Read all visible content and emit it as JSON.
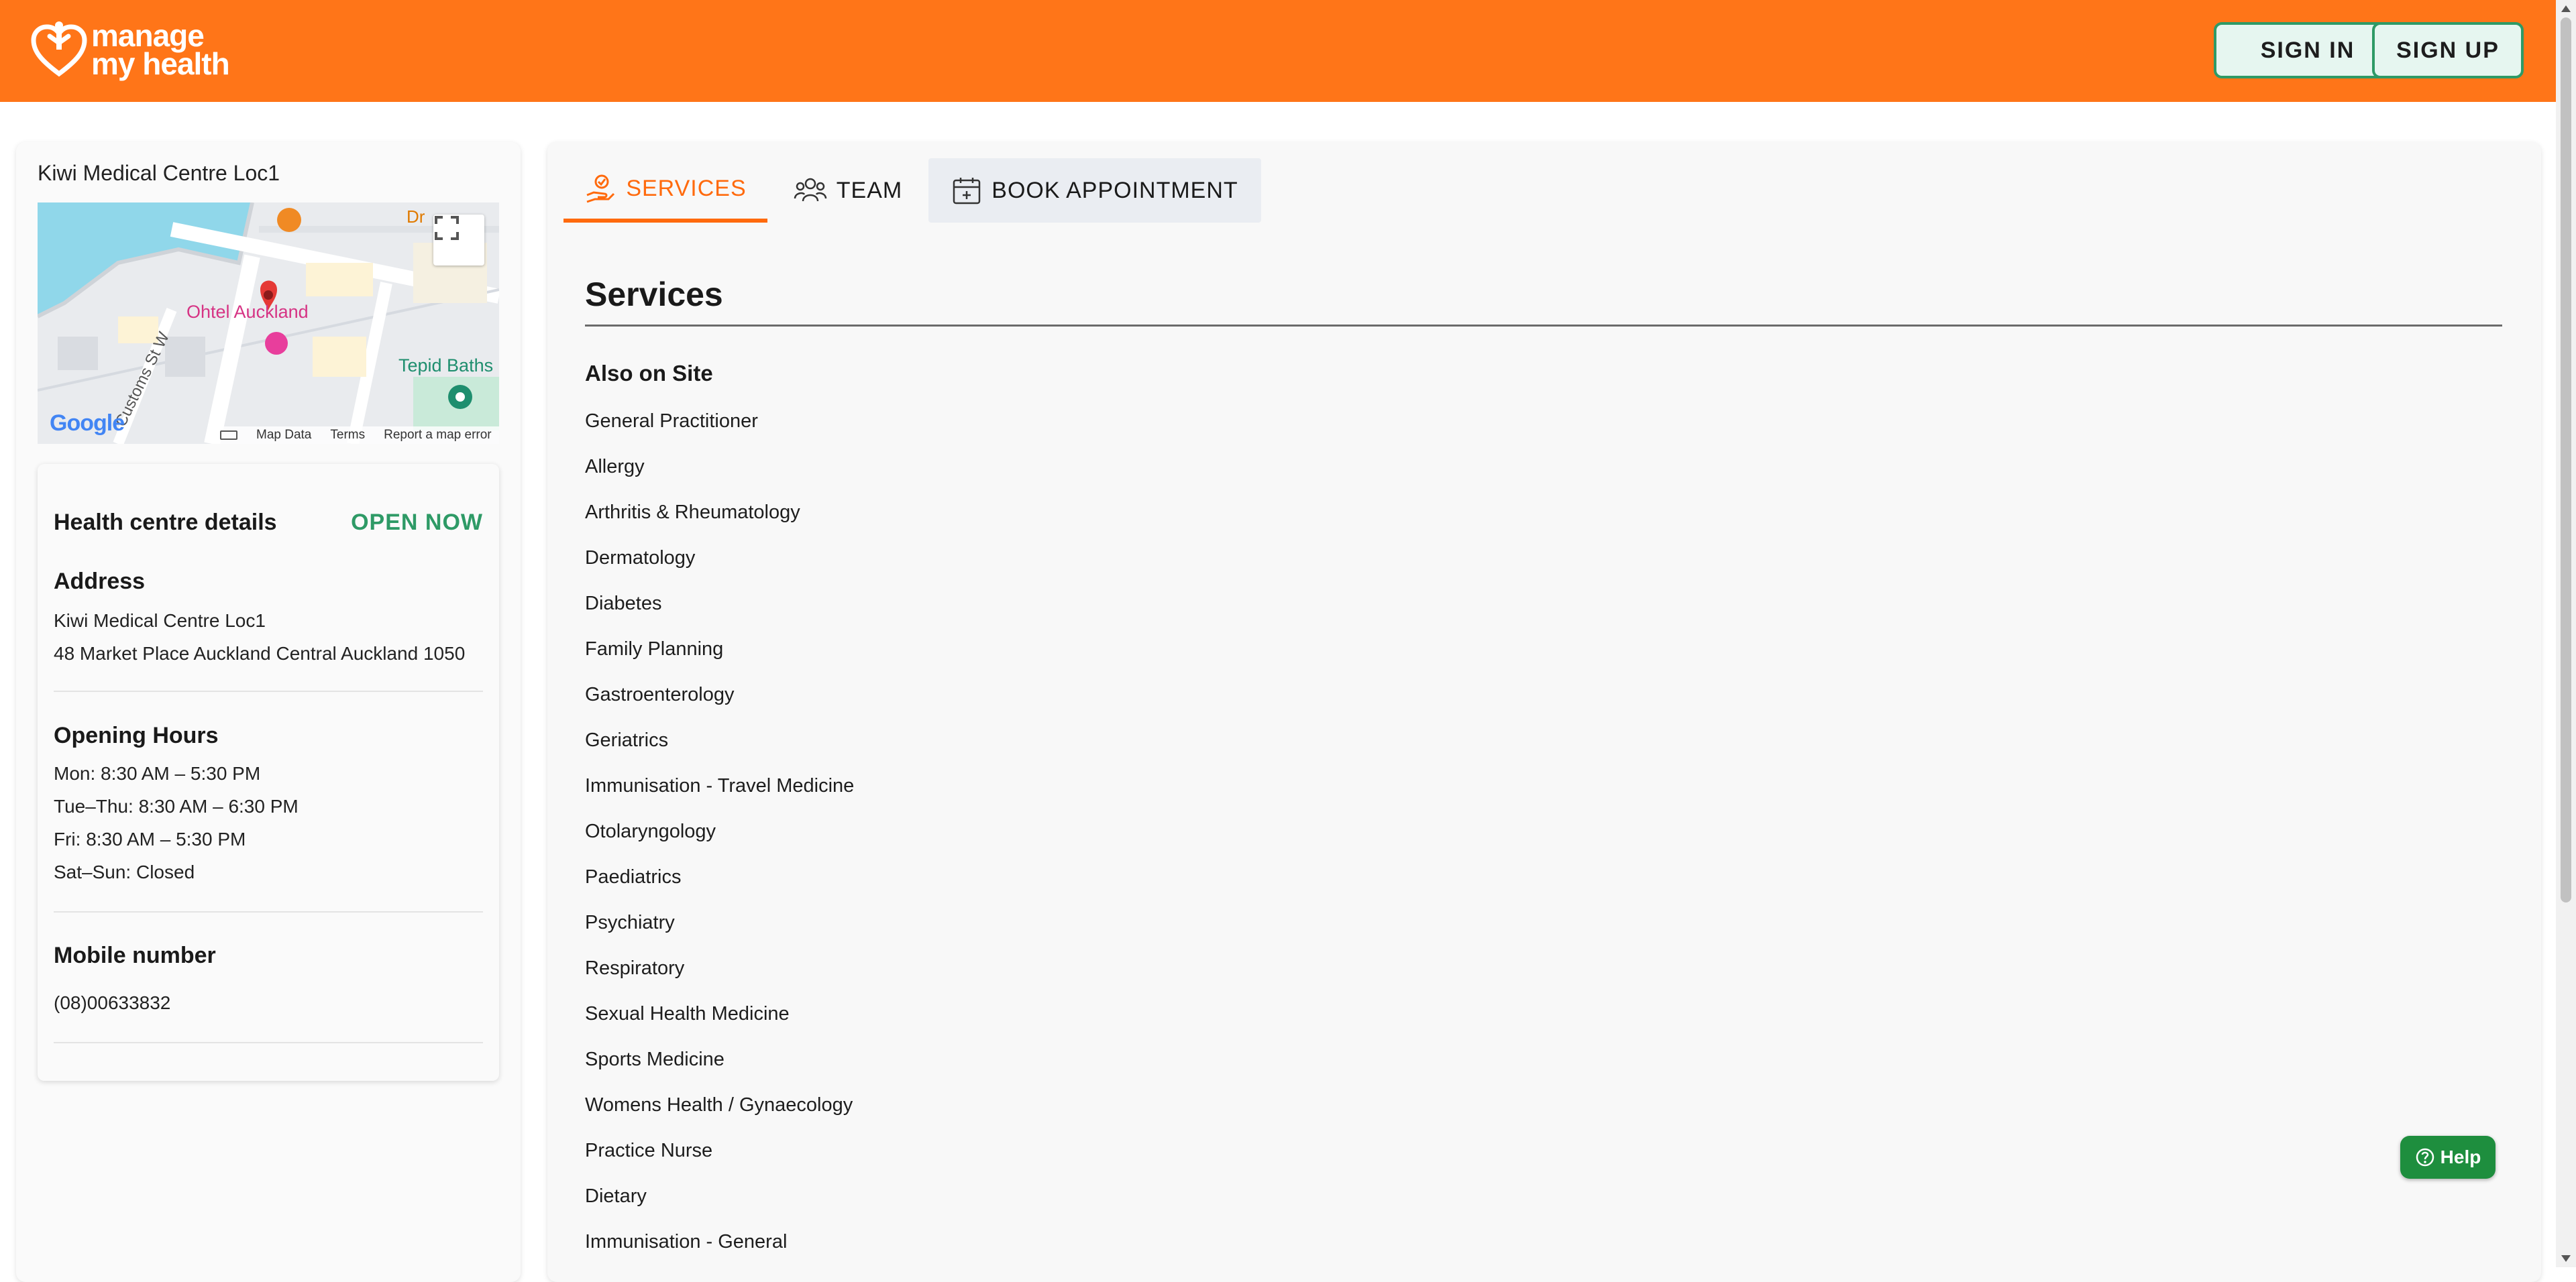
{
  "header": {
    "logo_line1": "manage",
    "logo_line2": "my health",
    "signin_label": "SIGN IN",
    "signup_label": "SIGN UP"
  },
  "clinic": {
    "name": "Kiwi Medical Centre Loc1"
  },
  "map": {
    "label_hotel": "Ohtel Auckland",
    "label_baths": "Tepid Baths",
    "label_street": "Customs St W",
    "label_corner": "Dr",
    "brand": "Google",
    "footer_map_data": "Map Data",
    "footer_terms": "Terms",
    "footer_report": "Report a map error"
  },
  "details": {
    "title": "Health centre details",
    "status": "OPEN NOW",
    "address_heading": "Address",
    "address_line1": "Kiwi Medical Centre Loc1",
    "address_line2": "48 Market Place Auckland Central Auckland 1050",
    "hours_heading": "Opening Hours",
    "hours": [
      "Mon: 8:30 AM – 5:30 PM",
      "Tue–Thu: 8:30 AM – 6:30 PM",
      "Fri: 8:30 AM – 5:30 PM",
      "Sat–Sun: Closed"
    ],
    "mobile_heading": "Mobile number",
    "mobile": "(08)00633832"
  },
  "tabs": {
    "services": "SERVICES",
    "team": "TEAM",
    "book": "BOOK APPOINTMENT"
  },
  "services": {
    "title": "Services",
    "subheading": "Also on Site",
    "items": [
      "General Practitioner",
      "Allergy",
      "Arthritis & Rheumatology",
      "Dermatology",
      "Diabetes",
      "Family Planning",
      "Gastroenterology",
      "Geriatrics",
      "Immunisation - Travel Medicine",
      "Otolaryngology",
      "Paediatrics",
      "Psychiatry",
      "Respiratory",
      "Sexual Health Medicine",
      "Sports Medicine",
      "Womens Health / Gynaecology",
      "Practice Nurse",
      "Dietary",
      "Immunisation - General"
    ]
  },
  "help": {
    "label": "Help"
  },
  "colors": {
    "brand_orange": "#ff7518",
    "accent_green": "#2e9a66",
    "tab_active": "#ff6a0d"
  }
}
